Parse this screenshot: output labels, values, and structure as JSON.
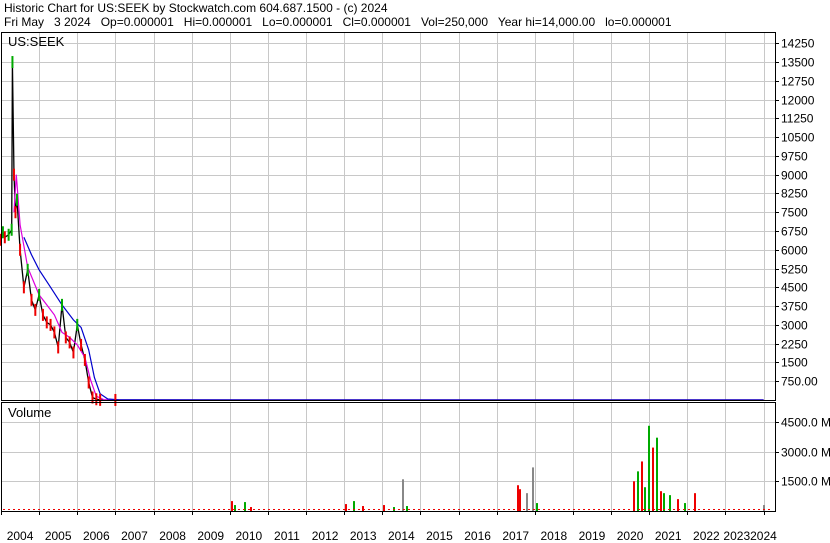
{
  "header": {
    "title": "Historic Chart for US:SEEK by Stockwatch.com 604.687.1500 - (c) 2024",
    "quote": "Fri May   3 2024   Op=0.000001   Hi=0.000001   Lo=0.000001   Cl=0.000001   Vol=250,000   Year hi=14,000.00   lo=0.000001"
  },
  "colors": {
    "up": "#00aa00",
    "down": "#ee0000",
    "ma_fast": "#dd00dd",
    "ma_slow": "#0000cc",
    "price_line": "#000000",
    "grid": "#c8c8c8",
    "volume_neutral": "#888888"
  },
  "chart_data": [
    {
      "type": "line",
      "panel_label": "US:SEEK",
      "y_axis_ticks": [
        "14250",
        "13500",
        "12750",
        "12000",
        "11250",
        "10500",
        "9750",
        "9000",
        "8250",
        "7500",
        "6750",
        "6000",
        "5250",
        "4500",
        "3750",
        "3000",
        "2250",
        "1500",
        "750.00"
      ],
      "ylim": [
        0,
        14700
      ],
      "grid": true,
      "series": [
        {
          "role": "close",
          "x": [
            2004.0,
            2004.05,
            2004.1,
            2004.2,
            2004.28,
            2004.3,
            2004.34,
            2004.38,
            2004.42,
            2004.5,
            2004.6,
            2004.7,
            2004.8,
            2004.9,
            2005.0,
            2005.1,
            2005.2,
            2005.3,
            2005.4,
            2005.5,
            2005.6,
            2005.7,
            2005.8,
            2005.9,
            2006.0,
            2006.1,
            2006.2,
            2006.3,
            2006.4,
            2006.5,
            2006.6,
            2007.0,
            2010.0,
            2015.0,
            2020.0,
            2024.0
          ],
          "y": [
            6400,
            6700,
            6500,
            6600,
            6800,
            13500,
            9000,
            7500,
            8000,
            6000,
            4500,
            5200,
            4000,
            3600,
            4200,
            3400,
            3100,
            3000,
            2700,
            2100,
            3800,
            2500,
            2300,
            1900,
            3000,
            2200,
            1600,
            700,
            100,
            30,
            5,
            1,
            0.5,
            0.2,
            0.1,
            1e-06
          ]
        },
        {
          "role": "moving-average-fast",
          "x": [
            2004.34,
            2004.4,
            2004.5,
            2004.7,
            2005.0,
            2005.2,
            2005.4,
            2005.6,
            2005.8,
            2006.0,
            2006.2,
            2006.35,
            2006.5,
            2006.7,
            2007.0,
            2024.0
          ],
          "y": [
            7500,
            9000,
            7000,
            5300,
            4200,
            3800,
            3400,
            2700,
            2500,
            2200,
            1700,
            800,
            150,
            10,
            1,
            1e-06
          ]
        },
        {
          "role": "moving-average-slow",
          "x": [
            2004.6,
            2004.8,
            2005.0,
            2005.3,
            2005.6,
            2005.9,
            2006.1,
            2006.3,
            2006.45,
            2006.6,
            2006.8,
            2007.1,
            2024.0
          ],
          "y": [
            6500,
            5800,
            5200,
            4500,
            3800,
            3200,
            2900,
            2000,
            900,
            250,
            40,
            2,
            1e-06
          ]
        }
      ]
    },
    {
      "type": "bar",
      "panel_label": "Volume",
      "y_axis_ticks": [
        "4500.0 M",
        "3000.0 M",
        "1500.0 M"
      ],
      "ylim": [
        0,
        5500
      ],
      "units": "M",
      "x_axis_ticks": [
        "2004",
        "2005",
        "2006",
        "2007",
        "2008",
        "2009",
        "2010",
        "2011",
        "2012",
        "2013",
        "2014",
        "2015",
        "2016",
        "2017",
        "2018",
        "2019",
        "2020",
        "2021",
        "2022",
        "2023",
        "2024"
      ],
      "x_axis_labels_printed": [
        "2004",
        "2005",
        "2006",
        "2007",
        "2008",
        "2009",
        "2010",
        "2011",
        "2012",
        "2013",
        "2014",
        "2015",
        "2016",
        "2017",
        "2018",
        "2019",
        "2020",
        "2021",
        "2022",
        "20232024"
      ],
      "series": [
        {
          "role": "volume",
          "x": [
            2010.05,
            2010.15,
            2010.4,
            2010.55,
            2013.05,
            2013.25,
            2013.5,
            2014.05,
            2014.3,
            2014.55,
            2014.65,
            2017.55,
            2017.6,
            2017.8,
            2017.95,
            2018.05,
            2020.6,
            2020.7,
            2020.8,
            2020.9,
            2021.0,
            2021.1,
            2021.2,
            2021.3,
            2021.4,
            2021.55,
            2021.75,
            2021.95,
            2022.2,
            2024.0
          ],
          "values": [
            500,
            300,
            450,
            200,
            350,
            500,
            250,
            300,
            200,
            1600,
            250,
            1300,
            1100,
            900,
            2200,
            400,
            1500,
            2000,
            2500,
            1200,
            4300,
            3200,
            3700,
            1000,
            900,
            800,
            600,
            400,
            900,
            300
          ],
          "colors": [
            "#ee0000",
            "#00aa00",
            "#00aa00",
            "#ee0000",
            "#ee0000",
            "#00aa00",
            "#ee0000",
            "#ee0000",
            "#00aa00",
            "#888888",
            "#00aa00",
            "#ee0000",
            "#ee0000",
            "#888888",
            "#888888",
            "#00aa00",
            "#ee0000",
            "#00aa00",
            "#ee0000",
            "#00aa00",
            "#00aa00",
            "#ee0000",
            "#00aa00",
            "#ee0000",
            "#00aa00",
            "#00aa00",
            "#ee0000",
            "#00aa00",
            "#ee0000",
            "#888888"
          ]
        }
      ]
    }
  ]
}
